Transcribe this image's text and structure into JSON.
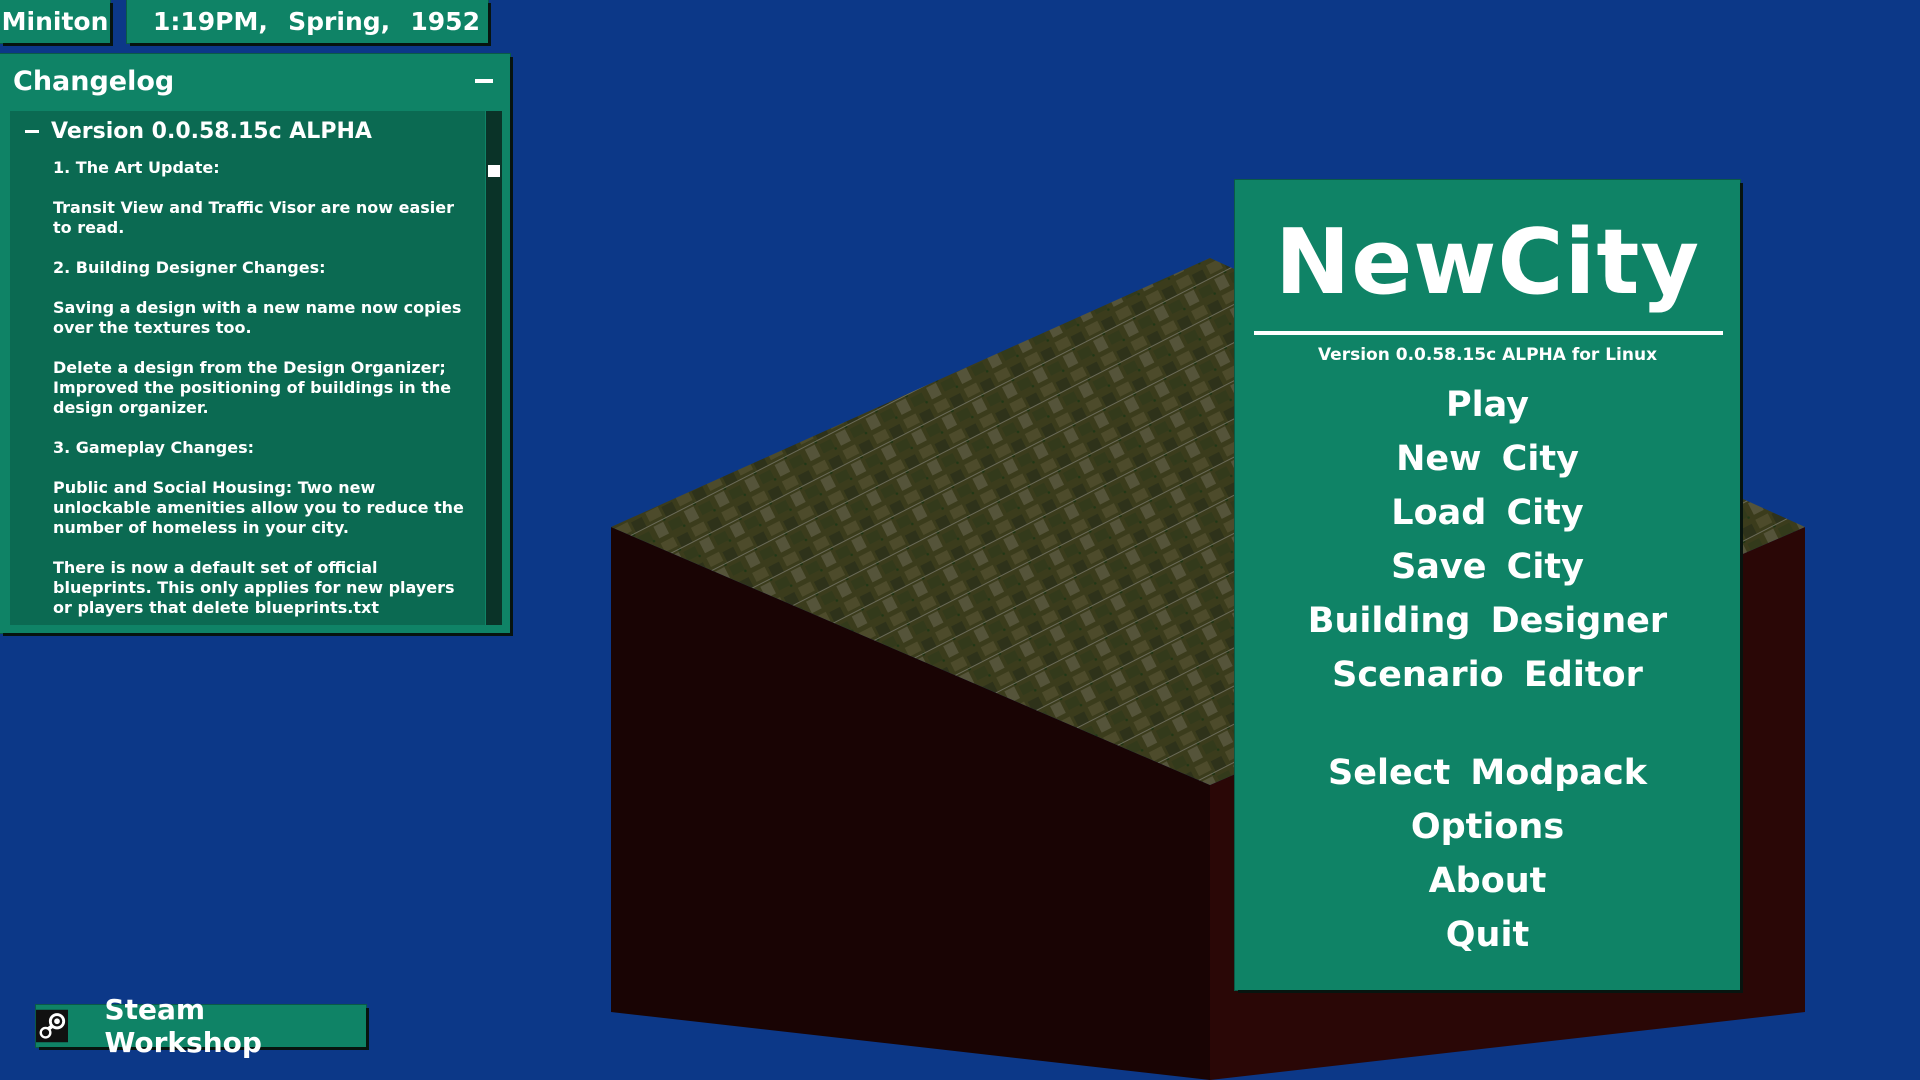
{
  "topbar": {
    "city_name": "Miniton",
    "time": "1:19PM,",
    "season": "Spring,",
    "year": "1952"
  },
  "changelog": {
    "title": "Changelog",
    "version_heading": "Version 0.0.58.15c ALPHA",
    "entries": [
      "1. The Art Update:",
      "Transit View and Traffic Visor are now easier to read.",
      "2. Building Designer Changes:",
      "Saving a design with a new name now copies over the textures too.",
      "Delete a design from the Design Organizer; Improved the positioning of buildings in the design organizer.",
      "3. Gameplay Changes:",
      "Public and Social Housing: Two new unlockable amenities allow you to reduce the number of homeless in your city.",
      "There is now a default set of official blueprints. This only applies for new players or players that delete blueprints.txt"
    ]
  },
  "main_menu": {
    "title": "NewCity",
    "version": "Version 0.0.58.15c ALPHA for Linux",
    "items": {
      "play": "Play",
      "new_city": "New City",
      "load_city": "Load City",
      "save_city": "Save City",
      "building_designer": "Building Designer",
      "scenario_editor": "Scenario Editor",
      "select_modpack": "Select Modpack",
      "options": "Options",
      "about": "About",
      "quit": "Quit"
    }
  },
  "steam_workshop": {
    "label": "Steam Workshop",
    "icon": "steam-icon"
  },
  "colors": {
    "background": "#0c3888",
    "panel": "#0f8366",
    "panel_dark": "#0b6a52",
    "text": "#ffffff"
  }
}
